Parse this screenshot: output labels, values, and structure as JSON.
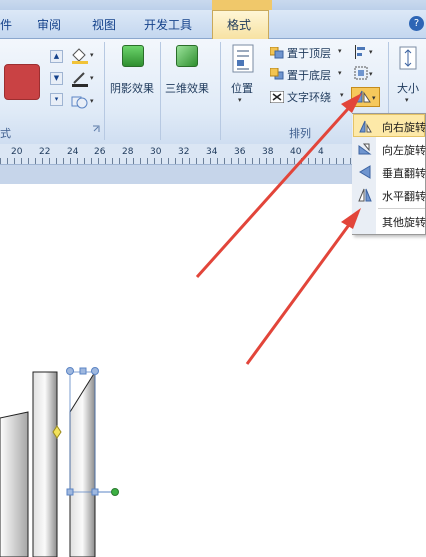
{
  "tabs": [
    {
      "id": "file",
      "label": "件"
    },
    {
      "id": "review",
      "label": "审阅"
    },
    {
      "id": "view",
      "label": "视图"
    },
    {
      "id": "developer",
      "label": "开发工具"
    },
    {
      "id": "format",
      "label": "格式",
      "active": true
    }
  ],
  "help": {
    "label": "?"
  },
  "ribbon": {
    "shape_styles": {
      "group_label": "式",
      "fill_color": "#c94244"
    },
    "shadow": {
      "label": "阴影效果"
    },
    "threed": {
      "label": "三维效果"
    },
    "arrange": {
      "group_label": "排列",
      "position": {
        "label": "位置"
      },
      "bring_front": {
        "label": "置于顶层"
      },
      "send_back": {
        "label": "置于底层"
      },
      "text_wrap": {
        "label": "文字环绕"
      }
    },
    "size": {
      "label": "大小"
    }
  },
  "ruler": {
    "ticks": [
      "20",
      "22",
      "24",
      "26",
      "28",
      "30",
      "32",
      "34",
      "36",
      "38",
      "40",
      "4"
    ]
  },
  "rotate_menu": {
    "items": [
      {
        "label": "向右旋转",
        "icon": "rotate-right-icon"
      },
      {
        "label": "向左旋转",
        "icon": "rotate-left-icon"
      },
      {
        "label": "垂直翻转",
        "icon": "flip-vertical-icon"
      },
      {
        "label": "水平翻转",
        "icon": "flip-horizontal-icon"
      },
      {
        "label": "其他旋转",
        "icon": "more-rotation-icon"
      }
    ]
  },
  "colors": {
    "accent_arrow": "#e2453a",
    "highlight": "#fde9a8",
    "handle_blue": "#5b84c4",
    "handle_green": "#3cb043",
    "handle_yellow": "#f3e25b"
  }
}
